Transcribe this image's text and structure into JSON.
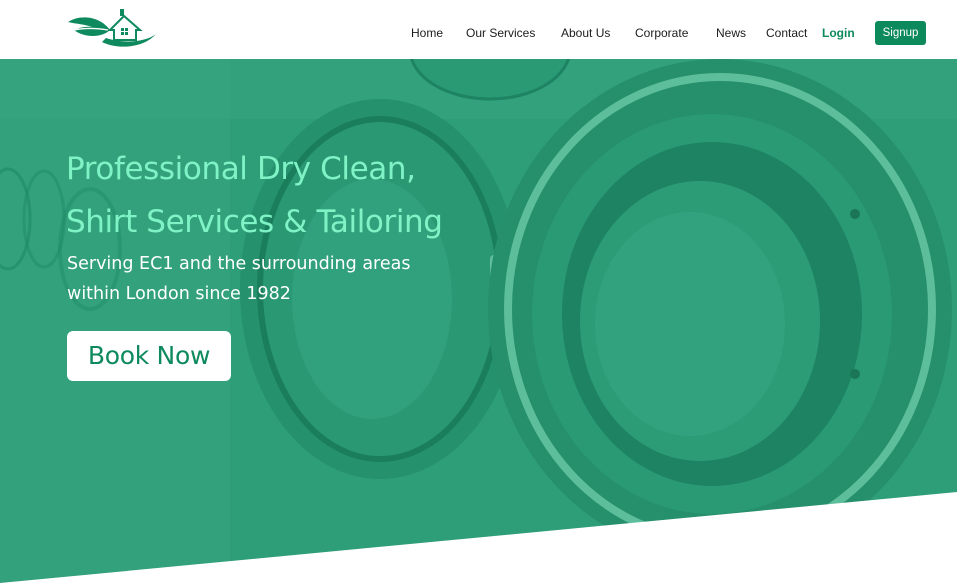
{
  "header": {
    "nav": [
      {
        "id": "home",
        "label": "Home"
      },
      {
        "id": "our-services",
        "label": "Our Services"
      },
      {
        "id": "about-us",
        "label": "About Us"
      },
      {
        "id": "corporate",
        "label": "Corporate"
      },
      {
        "id": "news",
        "label": "News"
      },
      {
        "id": "contact",
        "label": "Contact"
      }
    ],
    "login_label": "Login",
    "signup_label": "Signup"
  },
  "hero": {
    "title_line1": "Professional Dry Clean,",
    "title_line2": "Shirt Services & Tailoring",
    "subtitle_line1": "Serving EC1 and the surrounding areas",
    "subtitle_line2": "within London since 1982",
    "cta_label": "Book Now",
    "background_image": "washing-machines"
  },
  "colors": {
    "brand_green": "#0d8a5c",
    "hero_overlay": "#2e9e78",
    "title_mint": "#7ff3c6",
    "white": "#ffffff"
  },
  "icons": {
    "logo": "leaf-house-logo"
  }
}
